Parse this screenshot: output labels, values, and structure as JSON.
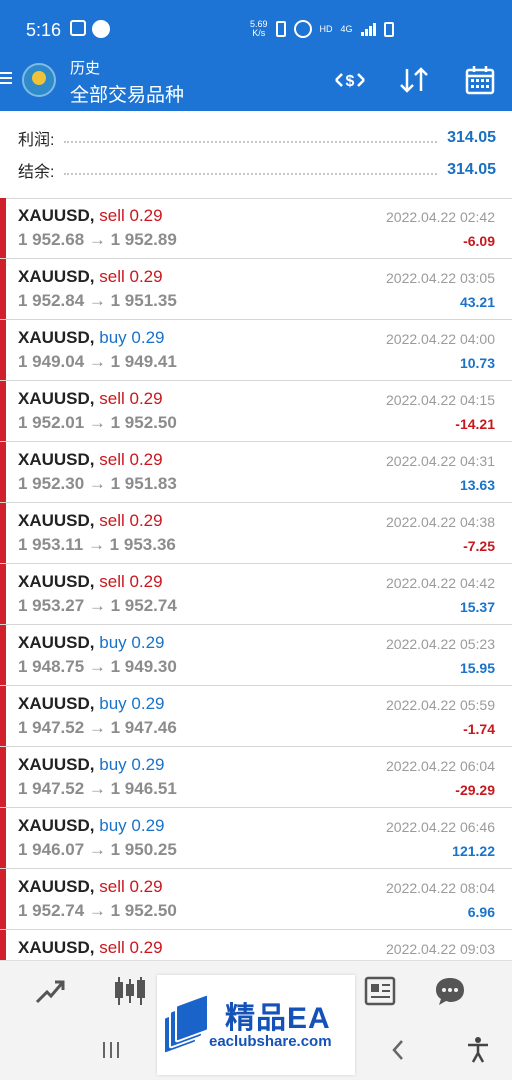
{
  "status_bar": {
    "time": "5:16",
    "speed_top": "5.69",
    "speed_bottom": "K/s",
    "hd": "HD",
    "net": "4G"
  },
  "app_bar": {
    "title": "历史",
    "subtitle": "全部交易品种",
    "icons": [
      "menu-icon",
      "app-logo",
      "deposit-withdraw-icon",
      "sort-icon",
      "calendar-icon"
    ]
  },
  "summary": {
    "profit_label": "利润:",
    "profit_value": "314.05",
    "balance_label": "结余:",
    "balance_value": "314.05"
  },
  "deals": [
    {
      "symbol": "XAUUSD,",
      "side": "sell",
      "volume": "0.29",
      "prices": "1 952.68 → 1 952.89",
      "time": "2022.04.22 02:42",
      "profit": "-6.09"
    },
    {
      "symbol": "XAUUSD,",
      "side": "sell",
      "volume": "0.29",
      "prices": "1 952.84 → 1 951.35",
      "time": "2022.04.22 03:05",
      "profit": "43.21"
    },
    {
      "symbol": "XAUUSD,",
      "side": "buy",
      "volume": "0.29",
      "prices": "1 949.04 → 1 949.41",
      "time": "2022.04.22 04:00",
      "profit": "10.73"
    },
    {
      "symbol": "XAUUSD,",
      "side": "sell",
      "volume": "0.29",
      "prices": "1 952.01 → 1 952.50",
      "time": "2022.04.22 04:15",
      "profit": "-14.21"
    },
    {
      "symbol": "XAUUSD,",
      "side": "sell",
      "volume": "0.29",
      "prices": "1 952.30 → 1 951.83",
      "time": "2022.04.22 04:31",
      "profit": "13.63"
    },
    {
      "symbol": "XAUUSD,",
      "side": "sell",
      "volume": "0.29",
      "prices": "1 953.11 → 1 953.36",
      "time": "2022.04.22 04:38",
      "profit": "-7.25"
    },
    {
      "symbol": "XAUUSD,",
      "side": "sell",
      "volume": "0.29",
      "prices": "1 953.27 → 1 952.74",
      "time": "2022.04.22 04:42",
      "profit": "15.37"
    },
    {
      "symbol": "XAUUSD,",
      "side": "buy",
      "volume": "0.29",
      "prices": "1 948.75 → 1 949.30",
      "time": "2022.04.22 05:23",
      "profit": "15.95"
    },
    {
      "symbol": "XAUUSD,",
      "side": "buy",
      "volume": "0.29",
      "prices": "1 947.52 → 1 947.46",
      "time": "2022.04.22 05:59",
      "profit": "-1.74"
    },
    {
      "symbol": "XAUUSD,",
      "side": "buy",
      "volume": "0.29",
      "prices": "1 947.52 → 1 946.51",
      "time": "2022.04.22 06:04",
      "profit": "-29.29"
    },
    {
      "symbol": "XAUUSD,",
      "side": "buy",
      "volume": "0.29",
      "prices": "1 946.07 → 1 950.25",
      "time": "2022.04.22 06:46",
      "profit": "121.22"
    },
    {
      "symbol": "XAUUSD,",
      "side": "sell",
      "volume": "0.29",
      "prices": "1 952.74 → 1 952.50",
      "time": "2022.04.22 08:04",
      "profit": "6.96"
    },
    {
      "symbol": "XAUUSD,",
      "side": "sell",
      "volume": "0.29",
      "prices": "",
      "time": "2022.04.22 09:03",
      "profit": ""
    }
  ],
  "bottom_nav": [
    "trade-icon",
    "chart-icon",
    "quotes-icon",
    "news-icon",
    "chat-icon"
  ],
  "watermark": {
    "brand": "精品EA",
    "url": "eaclubshare.com"
  },
  "colors": {
    "primary": "#1d74d4",
    "sell": "#c8181e",
    "buy": "#1a73c9",
    "row_bar": "#d0202b"
  }
}
